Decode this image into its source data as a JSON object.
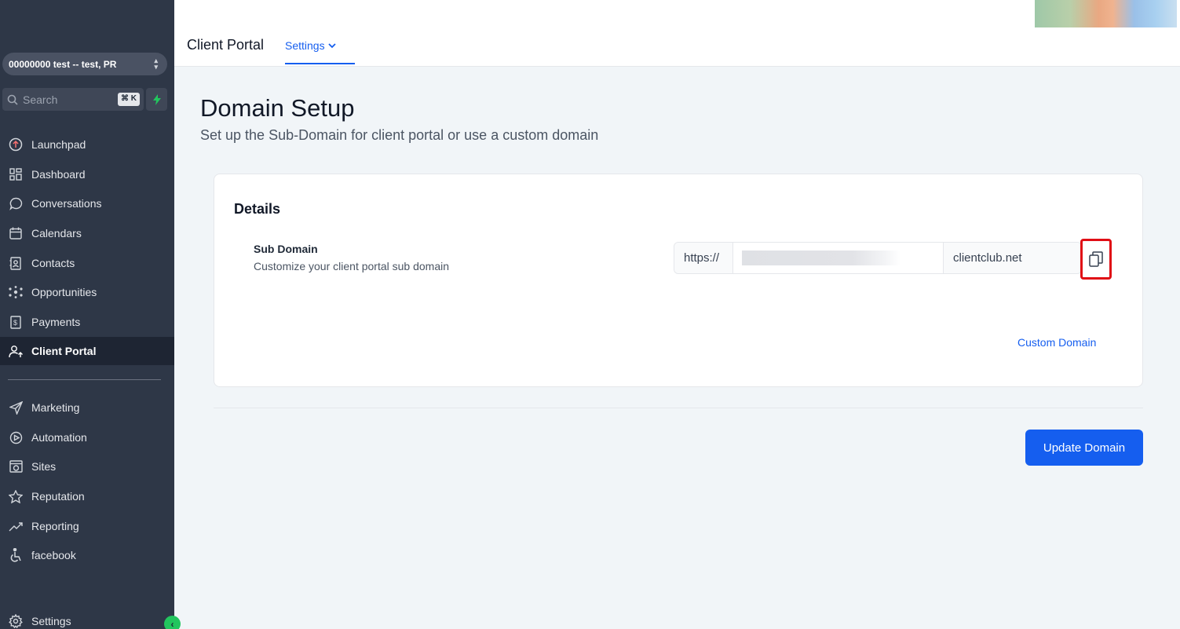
{
  "sidebar": {
    "account": "00000000 test -- test, PR",
    "search_placeholder": "Search",
    "search_shortcut": "⌘ K",
    "items": [
      {
        "label": "Launchpad",
        "icon": "launchpad-icon"
      },
      {
        "label": "Dashboard",
        "icon": "dashboard-grid-icon"
      },
      {
        "label": "Conversations",
        "icon": "chat-bubble-icon"
      },
      {
        "label": "Calendars",
        "icon": "calendar-icon"
      },
      {
        "label": "Contacts",
        "icon": "contact-book-icon"
      },
      {
        "label": "Opportunities",
        "icon": "opportunities-icon"
      },
      {
        "label": "Payments",
        "icon": "payments-icon"
      },
      {
        "label": "Client Portal",
        "icon": "client-portal-icon",
        "active": true
      },
      {
        "label": "Marketing",
        "icon": "send-icon"
      },
      {
        "label": "Automation",
        "icon": "automation-icon"
      },
      {
        "label": "Sites",
        "icon": "sites-globe-icon"
      },
      {
        "label": "Reputation",
        "icon": "star-icon"
      },
      {
        "label": "Reporting",
        "icon": "trend-icon"
      },
      {
        "label": "facebook",
        "icon": "accessibility-icon"
      },
      {
        "label": "Settings",
        "icon": "gear-icon"
      }
    ]
  },
  "header": {
    "title": "Client Portal",
    "tab_label": "Settings"
  },
  "main": {
    "title": "Domain Setup",
    "subtitle": "Set up the Sub-Domain for client portal or use a custom domain",
    "card": {
      "title": "Details",
      "field_label": "Sub Domain",
      "field_help": "Customize your client portal sub domain",
      "prefix": "https://",
      "subdomain_value": "",
      "suffix": "clientclub.net",
      "custom_domain_link": "Custom Domain"
    },
    "update_button": "Update Domain"
  },
  "colors": {
    "sidebar_bg": "#2e3747",
    "primary": "#155eef",
    "highlight_box": "#e00d15",
    "accent_green": "#22c55e"
  }
}
